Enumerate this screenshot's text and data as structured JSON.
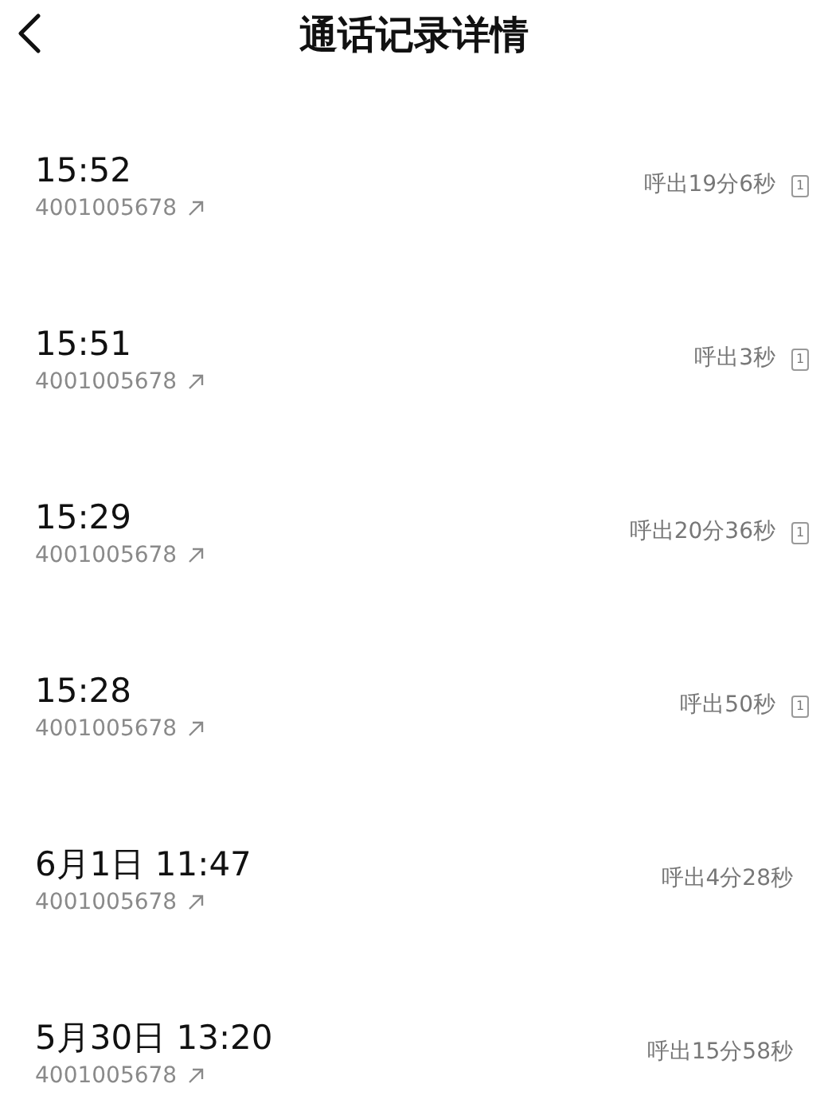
{
  "header": {
    "title": "通话记录详情"
  },
  "calls": [
    {
      "time": "15:52",
      "number": "4001005678",
      "duration": "呼出19分6秒",
      "sim": "1"
    },
    {
      "time": "15:51",
      "number": "4001005678",
      "duration": "呼出3秒",
      "sim": "1"
    },
    {
      "time": "15:29",
      "number": "4001005678",
      "duration": "呼出20分36秒",
      "sim": "1"
    },
    {
      "time": "15:28",
      "number": "4001005678",
      "duration": "呼出50秒",
      "sim": "1"
    },
    {
      "time": "6月1日 11:47",
      "number": "4001005678",
      "duration": "呼出4分28秒"
    },
    {
      "time": "5月30日 13:20",
      "number": "4001005678",
      "duration": "呼出15分58秒"
    }
  ]
}
